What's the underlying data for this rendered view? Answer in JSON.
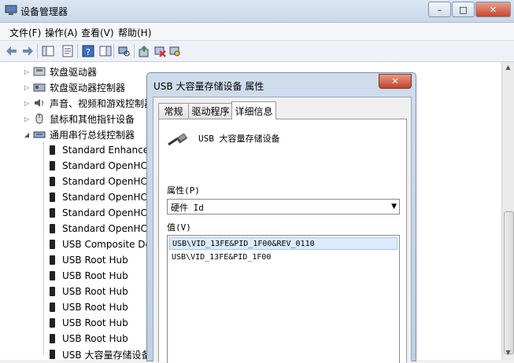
{
  "window": {
    "title": "设备管理器",
    "controls": {
      "minimize": "–",
      "maximize": "□",
      "close": "✕"
    }
  },
  "menu": [
    "文件(F)",
    "操作(A)",
    "查看(V)",
    "帮助(H)"
  ],
  "toolbar_icons": [
    "back-arrow-icon",
    "forward-arrow-icon",
    "console-tree-icon",
    "properties-icon",
    "help-icon",
    "console-icon",
    "scan-hardware-icon",
    "update-driver-icon",
    "uninstall-icon",
    "disable-icon"
  ],
  "tree": [
    {
      "label": "软盘驱动器",
      "icon": "floppy-drive-icon",
      "level": 1
    },
    {
      "label": "软盘驱动器控制器",
      "icon": "floppy-controller-icon",
      "level": 1
    },
    {
      "label": "声音、视频和游戏控制器",
      "icon": "sound-icon",
      "level": 1
    },
    {
      "label": "鼠标和其他指针设备",
      "icon": "mouse-icon",
      "level": 1
    },
    {
      "label": "通用串行总线控制器",
      "icon": "usb-controller-icon",
      "level": 1,
      "expanded": true
    },
    {
      "label": "Standard Enhanced PCI",
      "icon": "usb-plug-icon",
      "level": 2
    },
    {
      "label": "Standard OpenHCD US",
      "icon": "usb-plug-icon",
      "level": 2
    },
    {
      "label": "Standard OpenHCD US",
      "icon": "usb-plug-icon",
      "level": 2
    },
    {
      "label": "Standard OpenHCD US",
      "icon": "usb-plug-icon",
      "level": 2
    },
    {
      "label": "Standard OpenHCD US",
      "icon": "usb-plug-icon",
      "level": 2
    },
    {
      "label": "Standard OpenHCD US",
      "icon": "usb-plug-icon",
      "level": 2
    },
    {
      "label": "USB Composite Device",
      "icon": "usb-plug-icon",
      "level": 2
    },
    {
      "label": "USB Root Hub",
      "icon": "usb-plug-icon",
      "level": 2
    },
    {
      "label": "USB Root Hub",
      "icon": "usb-plug-icon",
      "level": 2
    },
    {
      "label": "USB Root Hub",
      "icon": "usb-plug-icon",
      "level": 2
    },
    {
      "label": "USB Root Hub",
      "icon": "usb-plug-icon",
      "level": 2
    },
    {
      "label": "USB Root Hub",
      "icon": "usb-plug-icon",
      "level": 2
    },
    {
      "label": "USB Root Hub",
      "icon": "usb-plug-icon",
      "level": 2
    },
    {
      "label": "USB 大容量存储设备",
      "icon": "usb-plug-icon",
      "level": 2
    }
  ],
  "dialog": {
    "title": "USB 大容量存储设备 属性",
    "close": "✕",
    "tabs": [
      "常规",
      "驱动程序",
      "详细信息"
    ],
    "active_tab": "详细信息",
    "device_name": "USB 大容量存储设备",
    "property_label": "属性(P)",
    "property_value": "硬件 Id",
    "value_label": "值(V)",
    "values": [
      "USB\\VID_13FE&PID_1F00&REV_0110",
      "USB\\VID_13FE&PID_1F00"
    ]
  }
}
